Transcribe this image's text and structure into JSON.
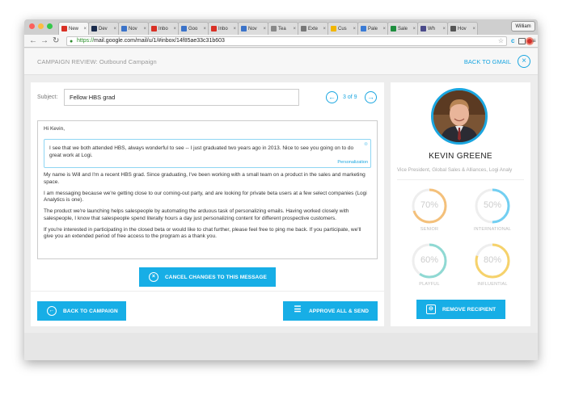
{
  "browser": {
    "tabs": [
      {
        "label": "New",
        "icon": "gmail-icon",
        "color": "#d93025"
      },
      {
        "label": "Dev",
        "icon": "d-icon",
        "color": "#1a2b4c"
      },
      {
        "label": "Nov",
        "icon": "calendar-icon",
        "color": "#3b73c9"
      },
      {
        "label": "Inbo",
        "icon": "gmail-icon",
        "color": "#d93025"
      },
      {
        "label": "Goo",
        "icon": "calendar-icon",
        "color": "#3b73c9"
      },
      {
        "label": "Inbo",
        "icon": "gmail-icon",
        "color": "#d93025"
      },
      {
        "label": "Nov",
        "icon": "calendar-icon",
        "color": "#3b73c9"
      },
      {
        "label": "Tea",
        "icon": "doc-icon",
        "color": "#888888"
      },
      {
        "label": "Exte",
        "icon": "puzzle-icon",
        "color": "#777777"
      },
      {
        "label": "Cus",
        "icon": "drive-icon",
        "color": "#f2b600"
      },
      {
        "label": "Pale",
        "icon": "palette-icon",
        "color": "#3a7bd5"
      },
      {
        "label": "Sale",
        "icon": "sheet-icon",
        "color": "#1e8e3e"
      },
      {
        "label": "Wh",
        "icon": "w-icon",
        "color": "#4a4a8a"
      },
      {
        "label": "Hov",
        "icon": "apple-icon",
        "color": "#555555"
      }
    ],
    "user": "William",
    "url_scheme": "https://",
    "url_rest": "mail.google.com/mail/u/1/#inbox/14f85ae33c31b603"
  },
  "header": {
    "title": "CAMPAIGN REVIEW: Outbound Campaign",
    "back_label": "BACK TO GMAIL"
  },
  "composer": {
    "subject_label": "Subject:",
    "subject_value": "Fellow HBS grad",
    "pager": "3 of 9",
    "greeting": "Hi Kevin,",
    "personalization_text": "I see that we both attended HBS, always wonderful to see -- I just graduated two years ago in 2013. Nice to see you going on to do great work at Logi.",
    "personalization_tag": "Personalization",
    "paragraphs": [
      "My name is Will and I'm a recent HBS grad. Since graduating, I've been working with a small team on a product in the sales and marketing space.",
      "I am messaging because we're getting close to our coming-out party, and are looking for private beta users at a few select companies (Logi Analytics is one).",
      "The product we're launching helps salespeople by automating the arduous task of personalizing emails. Having worked closely with salespeople, I know that salespeople spend literally hours a day just personalizing content for different prospective customers.",
      "If you're interested in participating in the closed beta or would like to chat further, please feel free to ping me back. If you participate, we'll give you an extended period of free access to the program as a thank you."
    ],
    "cancel_label": "CANCEL CHANGES TO THIS MESSAGE",
    "back_campaign_label": "BACK TO CAMPAIGN",
    "approve_label": "APPROVE ALL & SEND"
  },
  "recipient": {
    "name": "KEVIN GREENE",
    "title": "Vice President, Global Sales & Alliances, Logi Analy",
    "remove_label": "REMOVE RECIPIENT",
    "scores": [
      {
        "pct": "70%",
        "value": 0.7,
        "label": "SENIOR",
        "color": "#f4c07a"
      },
      {
        "pct": "50%",
        "value": 0.5,
        "label": "INTERNATIONAL",
        "color": "#72cff2"
      },
      {
        "pct": "60%",
        "value": 0.6,
        "label": "PLAYFUL",
        "color": "#8fd9d3"
      },
      {
        "pct": "80%",
        "value": 0.8,
        "label": "INFLUENTIAL",
        "color": "#f6d26b"
      }
    ]
  },
  "colors": {
    "accent": "#17aee6"
  }
}
